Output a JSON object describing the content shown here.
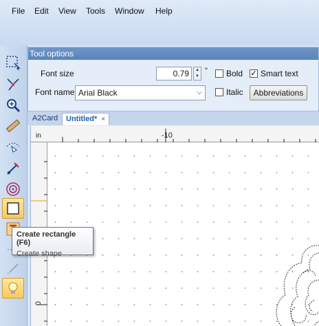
{
  "menu": {
    "items": [
      {
        "label": "File"
      },
      {
        "label": "Edit"
      },
      {
        "label": "View"
      },
      {
        "label": "Tools"
      },
      {
        "label": "Window"
      },
      {
        "label": "Help"
      }
    ]
  },
  "toolbar": {
    "tools": [
      {
        "icon": "selection-rectangle-icon"
      },
      {
        "icon": "node-edit-icon"
      },
      {
        "icon": "zoom-icon"
      },
      {
        "icon": "measure-ruler-icon"
      },
      {
        "icon": "bezier-draw-icon"
      },
      {
        "icon": "knife-icon"
      },
      {
        "icon": "spiral-shape-icon"
      },
      {
        "icon": "rectangle-shape-icon",
        "active": true
      },
      {
        "icon": "text-tool-icon"
      },
      {
        "icon": "grid-icon"
      },
      {
        "icon": "line-icon"
      },
      {
        "icon": "light-bulb-icon"
      }
    ]
  },
  "tool_options": {
    "title": "Tool options",
    "font_size_label": "Font size",
    "font_size_value": "0.79",
    "font_size_unit": "\"",
    "bold_label": "Bold",
    "bold_checked": false,
    "smart_text_label": "Smart text",
    "smart_text_checked": true,
    "font_name_label": "Font name",
    "font_name_value": "Arial Black",
    "italic_label": "Italic",
    "italic_checked": false,
    "abbreviations_label": "Abbreviations"
  },
  "tabs": [
    {
      "label": "A2Card",
      "active": false
    },
    {
      "label": "Untitled*",
      "active": true,
      "close": "×"
    }
  ],
  "ruler": {
    "unit_label": "in",
    "top_label": "-10",
    "left_label": "0"
  },
  "tooltip": {
    "title": "Create rectangle (F6)",
    "subtitle": "Create shape"
  },
  "colors": {
    "accent": "#5a84bd",
    "active_tool": "#f8c860"
  }
}
